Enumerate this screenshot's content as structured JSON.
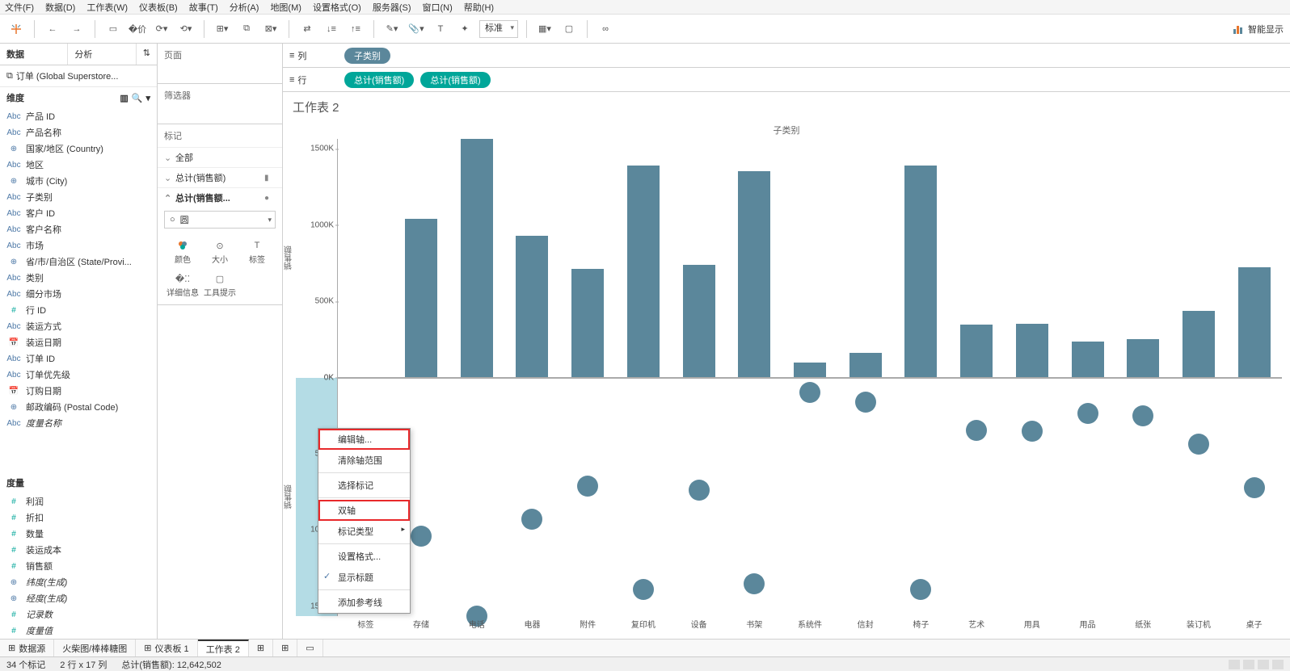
{
  "menu": [
    "文件(F)",
    "数据(D)",
    "工作表(W)",
    "仪表板(B)",
    "故事(T)",
    "分析(A)",
    "地图(M)",
    "设置格式(O)",
    "服务器(S)",
    "窗口(N)",
    "帮助(H)"
  ],
  "toolbar": {
    "std": "标准",
    "show_me": "智能显示"
  },
  "left": {
    "tab_data": "数据",
    "tab_analysis": "分析",
    "datasource": "订单 (Global Superstore...",
    "dims_hdr": "维度",
    "dims": [
      {
        "ico": "Abc",
        "t": "产品 ID"
      },
      {
        "ico": "Abc",
        "t": "产品名称"
      },
      {
        "ico": "⊕",
        "t": "国家/地区 (Country)"
      },
      {
        "ico": "Abc",
        "t": "地区"
      },
      {
        "ico": "⊕",
        "t": "城市 (City)"
      },
      {
        "ico": "Abc",
        "t": "子类别"
      },
      {
        "ico": "Abc",
        "t": "客户 ID"
      },
      {
        "ico": "Abc",
        "t": "客户名称"
      },
      {
        "ico": "Abc",
        "t": "市场"
      },
      {
        "ico": "⊕",
        "t": "省/市/自治区 (State/Provi..."
      },
      {
        "ico": "Abc",
        "t": "类别"
      },
      {
        "ico": "Abc",
        "t": "细分市场"
      },
      {
        "ico": "#",
        "t": "行 ID"
      },
      {
        "ico": "Abc",
        "t": "装运方式"
      },
      {
        "ico": "📅",
        "t": "装运日期"
      },
      {
        "ico": "Abc",
        "t": "订单 ID"
      },
      {
        "ico": "Abc",
        "t": "订单优先级"
      },
      {
        "ico": "📅",
        "t": "订购日期"
      },
      {
        "ico": "⊕",
        "t": "邮政编码 (Postal Code)"
      },
      {
        "ico": "Abc",
        "t": "度量名称",
        "i": true
      }
    ],
    "meas_hdr": "度量",
    "meas": [
      {
        "ico": "#",
        "t": "利润"
      },
      {
        "ico": "#",
        "t": "折扣"
      },
      {
        "ico": "#",
        "t": "数量"
      },
      {
        "ico": "#",
        "t": "装运成本"
      },
      {
        "ico": "#",
        "t": "销售额"
      },
      {
        "ico": "⊕",
        "t": "纬度(生成)",
        "i": true
      },
      {
        "ico": "⊕",
        "t": "经度(生成)",
        "i": true
      },
      {
        "ico": "#",
        "t": "记录数",
        "i": true
      },
      {
        "ico": "#",
        "t": "度量值",
        "i": true
      }
    ]
  },
  "mid": {
    "pages": "页面",
    "filters": "筛选器",
    "marks": "标记",
    "all": "全部",
    "m1": "总计(销售额)",
    "m2": "总计(销售额...",
    "shape": "圆",
    "color": "颜色",
    "size": "大小",
    "label": "标签",
    "detail": "详细信息",
    "tooltip": "工具提示"
  },
  "shelves": {
    "cols_lbl": "列",
    "rows_lbl": "行",
    "col_pill": "子类别",
    "row_pill1": "总计(销售额)",
    "row_pill2": "总计(销售额)"
  },
  "viz": {
    "title": "工作表 2",
    "axis_header": "子类别",
    "yaxis": "销售额"
  },
  "ctx": {
    "edit": "编辑轴...",
    "clear": "清除轴范围",
    "select": "选择标记",
    "dual": "双轴",
    "mtype": "标记类型",
    "fmt": "设置格式...",
    "showhdr": "显示标题",
    "ref": "添加参考线"
  },
  "tabs": {
    "ds": "数据源",
    "t1": "火柴图/棒棒糖图",
    "t2": "仪表板 1",
    "t3": "工作表 2"
  },
  "status": {
    "marks": "34 个标记",
    "rc": "2 行 x 17 列",
    "sum": "总计(销售额): 12,642,502"
  },
  "chart_data": {
    "type": "bar",
    "title": "工作表 2",
    "xlabel": "子类别",
    "ylabel": "销售额",
    "ylim": [
      0,
      1700000
    ],
    "yticks": [
      "0K",
      "500K",
      "1000K",
      "1500K"
    ],
    "categories": [
      "标签",
      "存储",
      "电话",
      "电器",
      "附件",
      "复印机",
      "设备",
      "书架",
      "系统件",
      "信封",
      "椅子",
      "艺术",
      "用具",
      "用品",
      "纸张",
      "装订机",
      "桌子"
    ],
    "series": [
      {
        "name": "总计(销售额) bar",
        "type": "bar",
        "values": [
          null,
          1130000,
          1700000,
          1010000,
          770000,
          1510000,
          800000,
          1470000,
          100000,
          170000,
          1510000,
          370000,
          380000,
          250000,
          270000,
          470000,
          780000
        ]
      },
      {
        "name": "总计(销售额) circle",
        "type": "scatter",
        "values": [
          null,
          1130000,
          1700000,
          1010000,
          770000,
          1510000,
          800000,
          1470000,
          100000,
          170000,
          1510000,
          370000,
          380000,
          250000,
          270000,
          470000,
          780000
        ]
      }
    ]
  }
}
